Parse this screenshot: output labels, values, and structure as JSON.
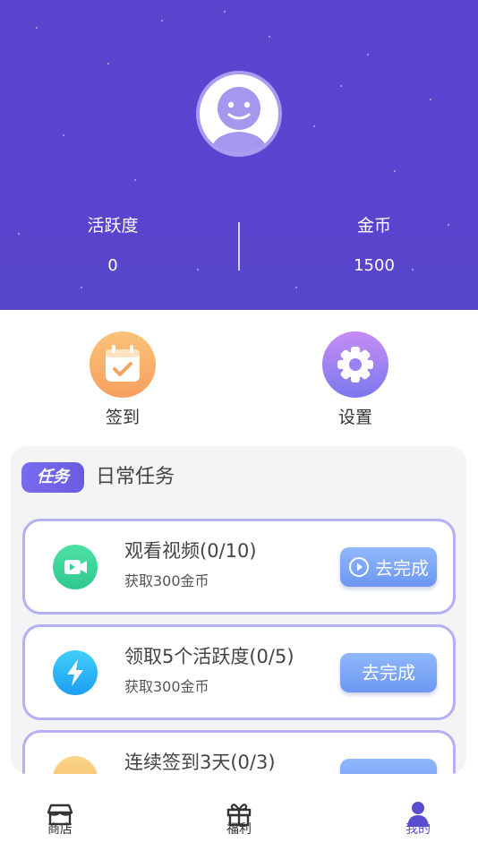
{
  "header": {
    "avatar_icon": "user-avatar-icon",
    "stats": [
      {
        "label": "活跃度",
        "value": "0"
      },
      {
        "label": "金币",
        "value": "1500"
      }
    ]
  },
  "quick_actions": [
    {
      "label": "签到",
      "icon": "calendar-check-icon"
    },
    {
      "label": "设置",
      "icon": "gear-icon"
    }
  ],
  "tasks_panel": {
    "badge": "任务",
    "title": "日常任务",
    "items": [
      {
        "title": "观看视频(0/10)",
        "subtitle": "获取300金币",
        "button": "去完成",
        "icon": "video-icon"
      },
      {
        "title": "领取5个活跃度(0/5)",
        "subtitle": "获取300金币",
        "button": "去完成",
        "icon": "lightning-icon"
      },
      {
        "title": "连续签到3天(0/3)",
        "subtitle": "",
        "button": "",
        "icon": "calendar-icon"
      }
    ]
  },
  "bottom_nav": [
    {
      "label": "商店",
      "icon": "shop-icon",
      "active": false
    },
    {
      "label": "福利",
      "icon": "gift-icon",
      "active": false
    },
    {
      "label": "我的",
      "icon": "person-icon",
      "active": true
    }
  ],
  "colors": {
    "header_bg": "#5a45cf",
    "accent": "#6a5ce0",
    "task_border": "#b3b0f3",
    "button_blue": "#7ba6f6",
    "nav_active": "#5a4ccf"
  }
}
